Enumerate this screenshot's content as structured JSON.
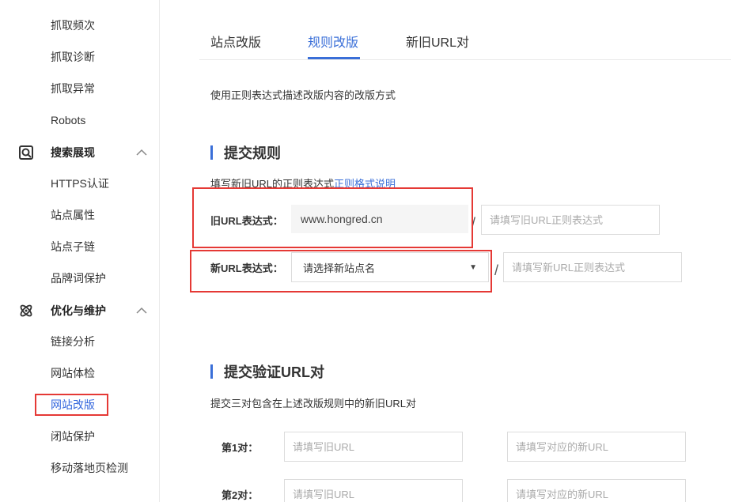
{
  "sidebar": {
    "items_top": [
      "抓取频次",
      "抓取诊断",
      "抓取异常",
      "Robots"
    ],
    "group_search": {
      "label": "搜索展现",
      "icon": "search-display-icon"
    },
    "items_search": [
      "HTTPS认证",
      "站点属性",
      "站点子链",
      "品牌词保护"
    ],
    "group_optimize": {
      "label": "优化与维护",
      "icon": "atom-icon"
    },
    "items_optimize": [
      "链接分析",
      "网站体检",
      "网站改版",
      "闭站保护",
      "移动落地页检测"
    ],
    "active_item": "网站改版"
  },
  "tabs": [
    "站点改版",
    "规则改版",
    "新旧URL对"
  ],
  "active_tab": "规则改版",
  "description": "使用正则表达式描述改版内容的改版方式",
  "submit_rule": {
    "title": "提交规则",
    "hint_prefix": "填写新旧URL的正则表达式",
    "hint_link": "正则格式说明",
    "old_label": "旧URL表达式：",
    "old_value": "www.hongred.cn",
    "slash": "/",
    "old_regex_placeholder": "请填写旧URL正则表达式",
    "new_label": "新URL表达式：",
    "new_select_value": "请选择新站点名",
    "new_regex_placeholder": "请填写新URL正则表达式"
  },
  "verify": {
    "title": "提交验证URL对",
    "hint": "提交三对包含在上述改版规则中的新旧URL对",
    "pairs": [
      {
        "label": "第1对：",
        "old_placeholder": "请填写旧URL",
        "new_placeholder": "请填写对应的新URL"
      },
      {
        "label": "第2对：",
        "old_placeholder": "请填写旧URL",
        "new_placeholder": "请填写对应的新URL"
      }
    ]
  },
  "colors": {
    "accent": "#3a6fd8",
    "highlight": "#e53935"
  }
}
